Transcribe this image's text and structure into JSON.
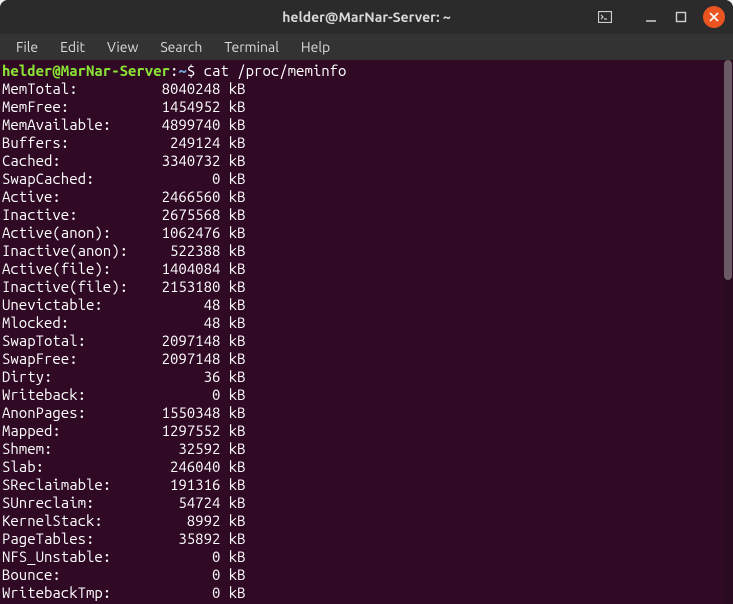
{
  "window": {
    "title": "helder@MarNar-Server: ~"
  },
  "menubar": {
    "items": [
      "File",
      "Edit",
      "View",
      "Search",
      "Terminal",
      "Help"
    ]
  },
  "prompt": {
    "user_host": "helder@MarNar-Server",
    "colon": ":",
    "path": "~",
    "symbol": "$",
    "command": "cat /proc/meminfo"
  },
  "meminfo": [
    {
      "label": "MemTotal:",
      "value": "8040248",
      "unit": "kB"
    },
    {
      "label": "MemFree:",
      "value": "1454952",
      "unit": "kB"
    },
    {
      "label": "MemAvailable:",
      "value": "4899740",
      "unit": "kB"
    },
    {
      "label": "Buffers:",
      "value": "249124",
      "unit": "kB"
    },
    {
      "label": "Cached:",
      "value": "3340732",
      "unit": "kB"
    },
    {
      "label": "SwapCached:",
      "value": "0",
      "unit": "kB"
    },
    {
      "label": "Active:",
      "value": "2466560",
      "unit": "kB"
    },
    {
      "label": "Inactive:",
      "value": "2675568",
      "unit": "kB"
    },
    {
      "label": "Active(anon):",
      "value": "1062476",
      "unit": "kB"
    },
    {
      "label": "Inactive(anon):",
      "value": "522388",
      "unit": "kB"
    },
    {
      "label": "Active(file):",
      "value": "1404084",
      "unit": "kB"
    },
    {
      "label": "Inactive(file):",
      "value": "2153180",
      "unit": "kB"
    },
    {
      "label": "Unevictable:",
      "value": "48",
      "unit": "kB"
    },
    {
      "label": "Mlocked:",
      "value": "48",
      "unit": "kB"
    },
    {
      "label": "SwapTotal:",
      "value": "2097148",
      "unit": "kB"
    },
    {
      "label": "SwapFree:",
      "value": "2097148",
      "unit": "kB"
    },
    {
      "label": "Dirty:",
      "value": "36",
      "unit": "kB"
    },
    {
      "label": "Writeback:",
      "value": "0",
      "unit": "kB"
    },
    {
      "label": "AnonPages:",
      "value": "1550348",
      "unit": "kB"
    },
    {
      "label": "Mapped:",
      "value": "1297552",
      "unit": "kB"
    },
    {
      "label": "Shmem:",
      "value": "32592",
      "unit": "kB"
    },
    {
      "label": "Slab:",
      "value": "246040",
      "unit": "kB"
    },
    {
      "label": "SReclaimable:",
      "value": "191316",
      "unit": "kB"
    },
    {
      "label": "SUnreclaim:",
      "value": "54724",
      "unit": "kB"
    },
    {
      "label": "KernelStack:",
      "value": "8992",
      "unit": "kB"
    },
    {
      "label": "PageTables:",
      "value": "35892",
      "unit": "kB"
    },
    {
      "label": "NFS_Unstable:",
      "value": "0",
      "unit": "kB"
    },
    {
      "label": "Bounce:",
      "value": "0",
      "unit": "kB"
    },
    {
      "label": "WritebackTmp:",
      "value": "0",
      "unit": "kB"
    }
  ]
}
